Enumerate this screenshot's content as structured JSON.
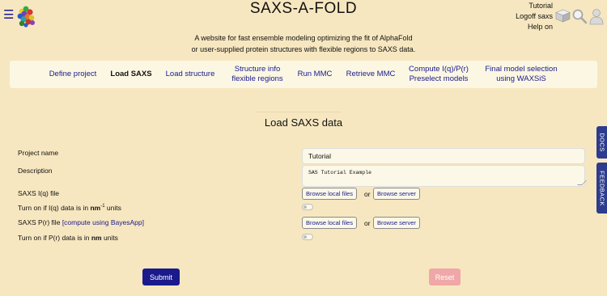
{
  "app": {
    "title": "SAXS-A-FOLD",
    "subtitle_line1": "A website for fast ensemble modeling optimizing the fit of AlphaFold",
    "subtitle_line2": "or user-supplied protein structures with flexible regions to SAXS data."
  },
  "user": {
    "project": "Tutorial",
    "logoff": "Logoff saxs",
    "help": "Help on"
  },
  "icons": {
    "menu": "hamburger-menu-icon",
    "logo": "protein-ensemble-logo",
    "cube": "cube-icon",
    "search": "search-icon",
    "person": "person-icon"
  },
  "nav": {
    "items": [
      {
        "line1": "Define project",
        "line2": ""
      },
      {
        "line1": "Load SAXS",
        "line2": ""
      },
      {
        "line1": "Load structure",
        "line2": ""
      },
      {
        "line1": "Structure info",
        "line2": "flexible regions"
      },
      {
        "line1": "Run MMC",
        "line2": ""
      },
      {
        "line1": "Retrieve MMC",
        "line2": ""
      },
      {
        "line1": "Compute I(q)/P(r)",
        "line2": "Preselect models"
      },
      {
        "line1": "Final model selection",
        "line2": "using WAXSiS"
      }
    ],
    "active_index": 1
  },
  "page": {
    "section_title": "Load SAXS data"
  },
  "form": {
    "project_name_label": "Project name",
    "project_name_value": "Tutorial",
    "description_label": "Description",
    "description_value": "SAS Tutorial Example",
    "saxs_iq_label": "SAXS I(q) file",
    "browse_local": "Browse local files",
    "or": "or",
    "browse_server": "Browse server",
    "iq_units_prefix": "Turn on if I(q) data is in ",
    "iq_units_bold": "nm",
    "iq_units_sup": "-1",
    "iq_units_suffix": " units",
    "iq_units_toggle_on": false,
    "saxs_pr_label": "SAXS P(r) file",
    "pr_link": "[compute using BayesApp]",
    "pr_units_prefix": "Turn on if P(r) data is in ",
    "pr_units_bold": "nm",
    "pr_units_suffix": " units",
    "pr_units_toggle_on": false
  },
  "actions": {
    "submit": "Submit",
    "reset": "Reset"
  },
  "side_tabs": {
    "docs": "DOCS",
    "feedback": "FEEDBACK"
  },
  "colors": {
    "background": "#f7e7c0",
    "link": "#1a1a8c",
    "submit": "#1a1a8c",
    "reset": "#f0a7a7",
    "side_tab": "#2d3c8e"
  }
}
